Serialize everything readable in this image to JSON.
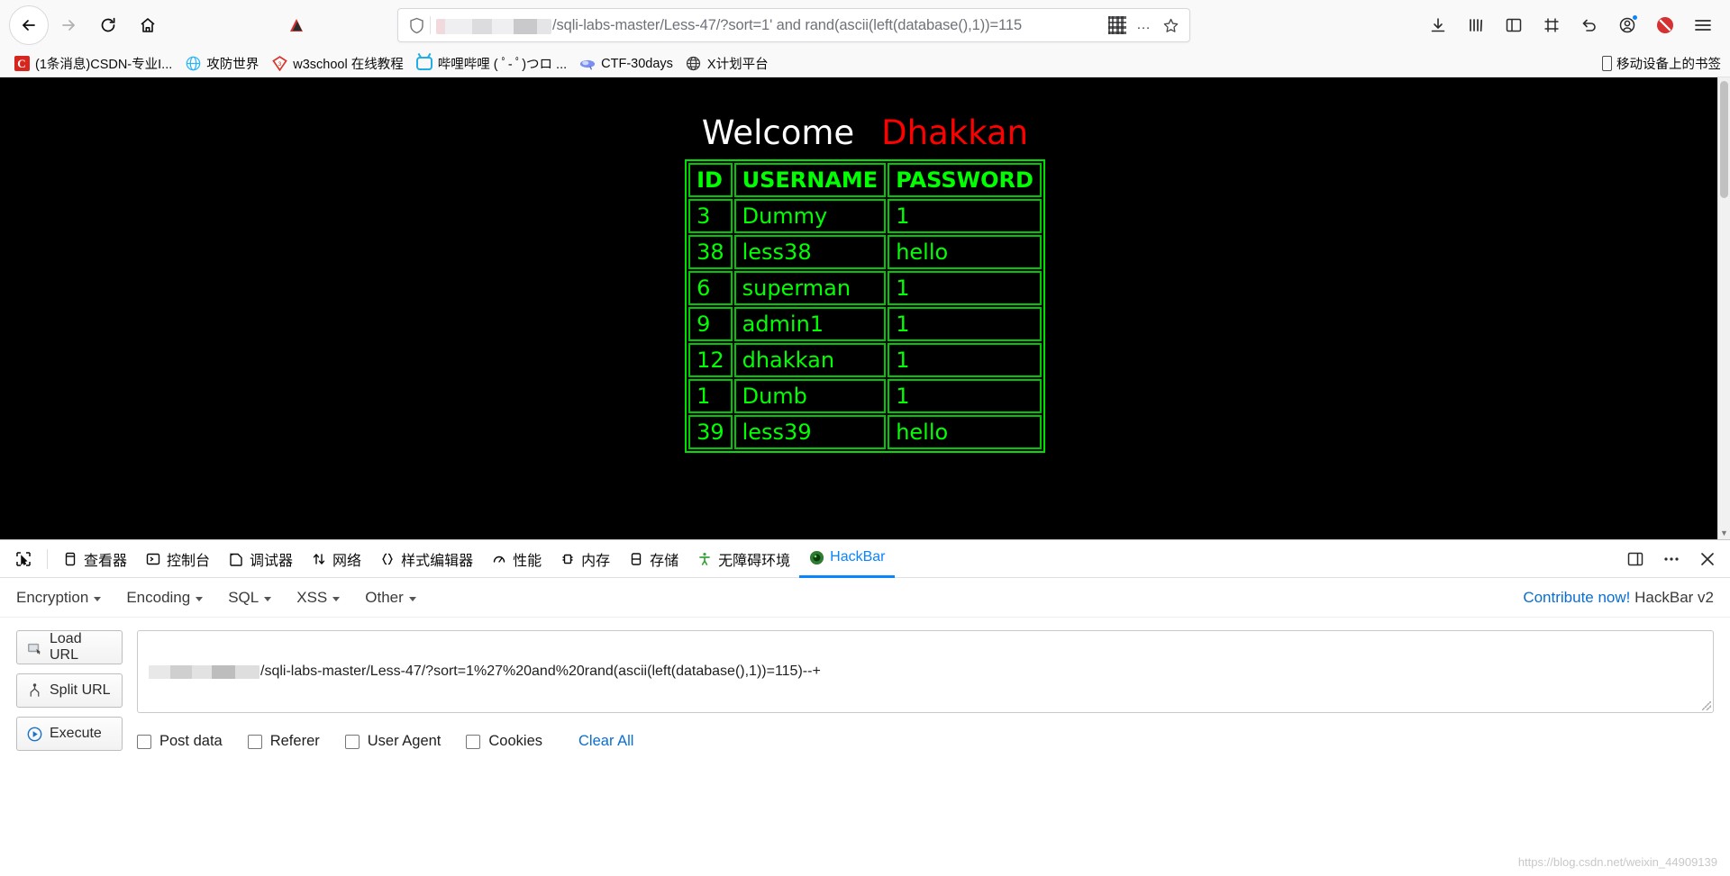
{
  "browser": {
    "nav": {
      "back": "back-arrow",
      "forward": "forward-arrow",
      "reload": "reload",
      "home": "home"
    },
    "urlbar": {
      "shield": "shield-icon",
      "url_text": "/sqli-labs-master/Less-47/?sort=1' and rand(ascii(left(database(),1))=115",
      "redacted_host": "",
      "qr": "qr-icon",
      "more": "…",
      "bookmark_star": "☆"
    },
    "toolbar_right": [
      "downloads-icon",
      "library-icon",
      "sidebar-icon",
      "screenshot-icon",
      "undo-icon",
      "account-icon",
      "blocker-icon",
      "menu-icon"
    ]
  },
  "bookmarks": {
    "items": [
      {
        "icon": "csdn-icon",
        "label": "(1条消息)CSDN-专业I..."
      },
      {
        "icon": "globe-blue-icon",
        "label": "攻防世界"
      },
      {
        "icon": "w3school-icon",
        "label": "w3school 在线教程"
      },
      {
        "icon": "bilibili-icon",
        "label": "哔哩哔哩 ( ﾟ- ﾟ)つロ ..."
      },
      {
        "icon": "ctf-icon",
        "label": "CTF-30days"
      },
      {
        "icon": "globe-icon",
        "label": "X计划平台"
      }
    ],
    "right_label": "移动设备上的书签"
  },
  "page": {
    "welcome": "Welcome",
    "name": "Dhakkan",
    "table": {
      "headers": [
        "ID",
        "USERNAME",
        "PASSWORD"
      ],
      "rows": [
        [
          "3",
          "Dummy",
          "1"
        ],
        [
          "38",
          "less38",
          "hello"
        ],
        [
          "6",
          "superman",
          "1"
        ],
        [
          "9",
          "admin1",
          "1"
        ],
        [
          "12",
          "dhakkan",
          "1"
        ],
        [
          "1",
          "Dumb",
          "1"
        ],
        [
          "39",
          "less39",
          "hello"
        ]
      ]
    }
  },
  "devtools": {
    "picker": "element-picker-icon",
    "tabs": [
      {
        "icon": "inspector-icon",
        "label": "查看器",
        "active": false
      },
      {
        "icon": "console-icon",
        "label": "控制台",
        "active": false
      },
      {
        "icon": "debugger-icon",
        "label": "调试器",
        "active": false
      },
      {
        "icon": "network-icon",
        "label": "网络",
        "active": false
      },
      {
        "icon": "style-editor-icon",
        "label": "样式编辑器",
        "active": false
      },
      {
        "icon": "performance-icon",
        "label": "性能",
        "active": false
      },
      {
        "icon": "memory-icon",
        "label": "内存",
        "active": false
      },
      {
        "icon": "storage-icon",
        "label": "存储",
        "active": false
      },
      {
        "icon": "accessibility-icon",
        "label": "无障碍环境",
        "active": false
      },
      {
        "icon": "hackbar-icon",
        "label": "HackBar",
        "active": true
      }
    ],
    "right_buttons": [
      "dock-icon",
      "more-icon",
      "close-icon"
    ]
  },
  "hackbar": {
    "menus": [
      "Encryption",
      "Encoding",
      "SQL",
      "XSS",
      "Other"
    ],
    "contribute_link": "Contribute now!",
    "version_label": "HackBar v2",
    "buttons": [
      {
        "icon": "load-url-icon",
        "label": "Load URL"
      },
      {
        "icon": "split-url-icon",
        "label": "Split URL"
      },
      {
        "icon": "execute-icon",
        "label": "Execute"
      }
    ],
    "url_value": "/sqli-labs-master/Less-47/?sort=1%27%20and%20rand(ascii(left(database(),1))=115)--+",
    "checkboxes": [
      "Post data",
      "Referer",
      "User Agent",
      "Cookies"
    ],
    "clear_all": "Clear All"
  },
  "watermark": "https://blog.csdn.net/weixin_44909139",
  "colors": {
    "accent": "#0a84ff",
    "terminal_green": "#00ff00",
    "name_red": "#ff0000",
    "link_blue": "#0a6ed1"
  }
}
